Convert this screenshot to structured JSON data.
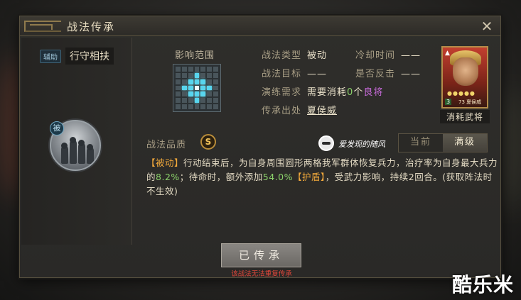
{
  "dialog": {
    "title": "战法传承",
    "close_glyph": "✕"
  },
  "skill": {
    "category_badge": "辅助",
    "name": "行守相扶",
    "passive_badge": "被"
  },
  "range": {
    "label": "影响范围"
  },
  "info": {
    "type_key": "战法类型",
    "type_val": "被动",
    "cooldown_key": "冷却时间",
    "cooldown_val": "——",
    "target_key": "战法目标",
    "target_val": "——",
    "counter_key": "是否反击",
    "counter_val": "——",
    "train_key": "演练需求",
    "train_prefix": "需要消耗",
    "train_count": "0",
    "train_unit": "个",
    "train_item": "良将",
    "source_key": "传承出处",
    "source_val": "夏侯威"
  },
  "general_card": {
    "corner": "▲",
    "stars": "●●●●●",
    "cost": "3",
    "name": "73 夏侯威",
    "label": "消耗武将"
  },
  "quality": {
    "label": "战法品质",
    "grade": "S"
  },
  "watermark_chip": {
    "text": "爱发现的随风"
  },
  "level_tabs": [
    {
      "label": "当前",
      "active": false
    },
    {
      "label": "满级",
      "active": true
    }
  ],
  "description": {
    "tag": "【被动】",
    "p1": "行动结束后，为自身周围圆形两格我军群体恢复兵力，治疗率为自身最大兵力的",
    "v1": "8.2%",
    "p2": "；待命时，额外添加",
    "v2": "54.0%",
    "tag2": "【护盾】",
    "p3": "，受武力影响，持续2回合。(获取阵法时不生效)"
  },
  "action": {
    "inherit_label": "已传承",
    "warning": "该战法无法重复传承"
  },
  "site_watermark": "酷乐米",
  "colors": {
    "accent_green": "#8bd06a",
    "accent_orange": "#f2a93b",
    "accent_purple": "#c66ad8",
    "warning_red": "#e0463a",
    "range_cell": "#58d5ee"
  }
}
